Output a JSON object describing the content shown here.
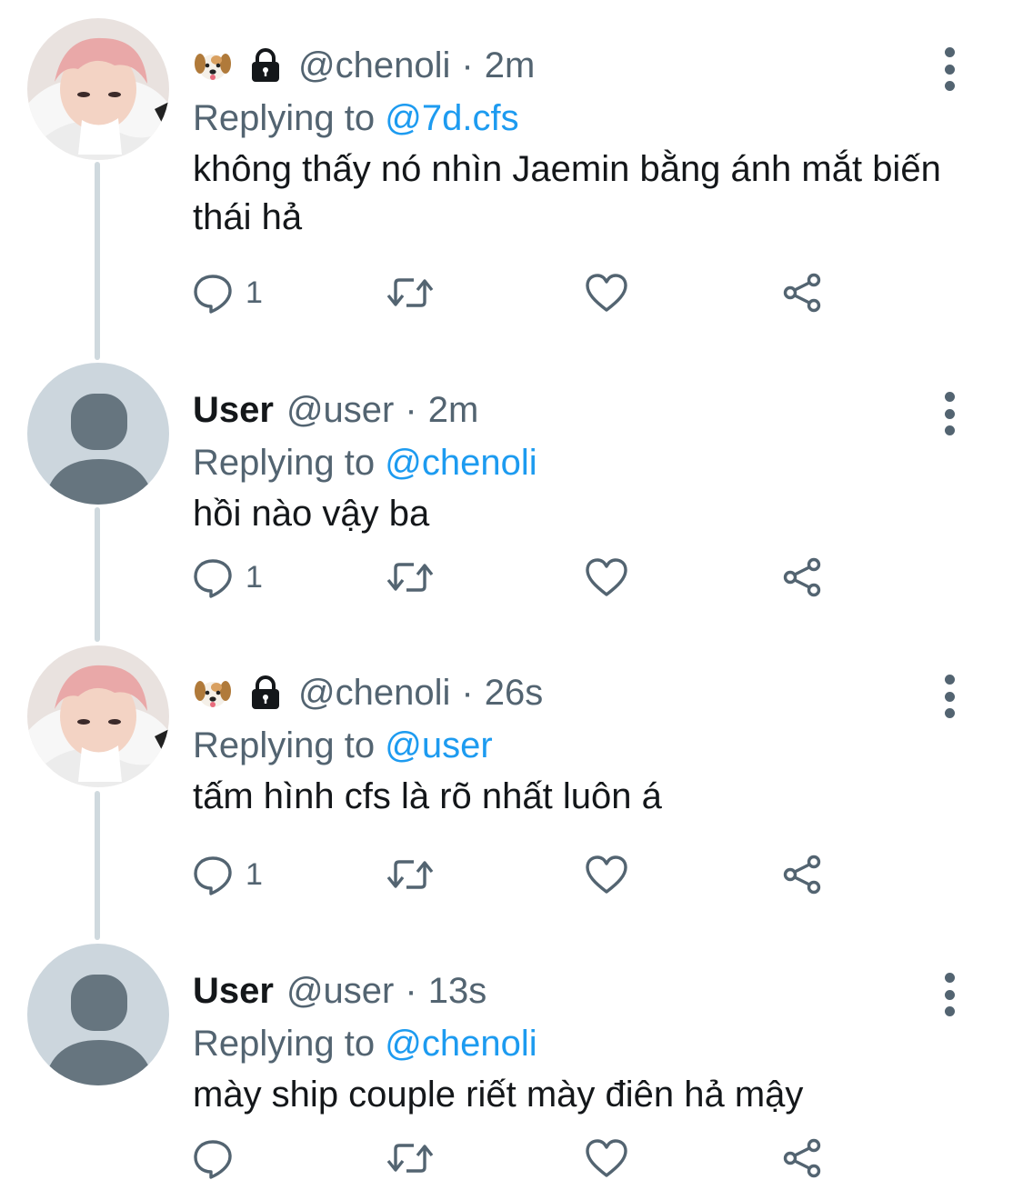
{
  "tweets": [
    {
      "avatar_type": "photo",
      "display_name": "",
      "handle": "@chenoli",
      "time": "2m",
      "emoji": [
        "dog-face-icon",
        "lock-icon"
      ],
      "replying_label": "Replying to",
      "replying_to": "@7d.cfs",
      "text": "không thấy nó nhìn Jaemin bằng ánh mắt biến thái hả",
      "reply_count": "1"
    },
    {
      "avatar_type": "default",
      "display_name": "User",
      "handle": "@user",
      "time": "2m",
      "emoji": [],
      "replying_label": "Replying to",
      "replying_to": "@chenoli",
      "text": "hồi nào vậy ba",
      "reply_count": "1"
    },
    {
      "avatar_type": "photo",
      "display_name": "",
      "handle": "@chenoli",
      "time": "26s",
      "emoji": [
        "dog-face-icon",
        "lock-icon"
      ],
      "replying_label": "Replying to",
      "replying_to": "@user",
      "text": "tấm hình cfs là rõ nhất luôn á",
      "reply_count": "1"
    },
    {
      "avatar_type": "default",
      "display_name": "User",
      "handle": "@user",
      "time": "13s",
      "emoji": [],
      "replying_label": "Replying to",
      "replying_to": "@chenoli",
      "text": "mày ship couple riết mày điên hả mậy",
      "reply_count": ""
    }
  ],
  "separator": "·",
  "colors": {
    "link": "#1d9bf0",
    "secondary_text": "#536471",
    "thread_line": "#cfd9de",
    "default_avatar_bg": "#ccd6dd",
    "default_avatar_fg": "#66757f"
  }
}
